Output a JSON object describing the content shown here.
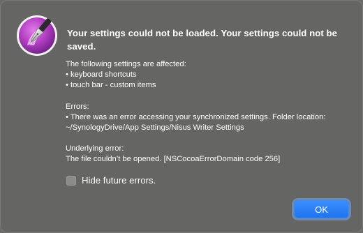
{
  "app_icon": "nisus-writer-fountain-pen-icon",
  "title": "Your settings could not be loaded. Your settings could not be saved.",
  "affected": {
    "heading": "The following settings are affected:",
    "items": [
      "• keyboard shortcuts",
      "• touch bar - custom items"
    ]
  },
  "errors": {
    "heading": "Errors:",
    "lines": [
      "• There was an error accessing your synchronized settings. Folder location:",
      "~/SynologyDrive/App Settings/Nisus Writer Settings"
    ]
  },
  "underlying": {
    "heading": "Underlying error:",
    "message": "The file couldn’t be opened. [NSCocoaErrorDomain code 256]"
  },
  "hide_future_errors": {
    "label": "Hide future errors.",
    "checked": false
  },
  "ok_button": {
    "label": "OK"
  },
  "colors": {
    "dialog_background": "#656563",
    "accent": "#1f74f0",
    "icon_purple": "#b43fc4"
  }
}
